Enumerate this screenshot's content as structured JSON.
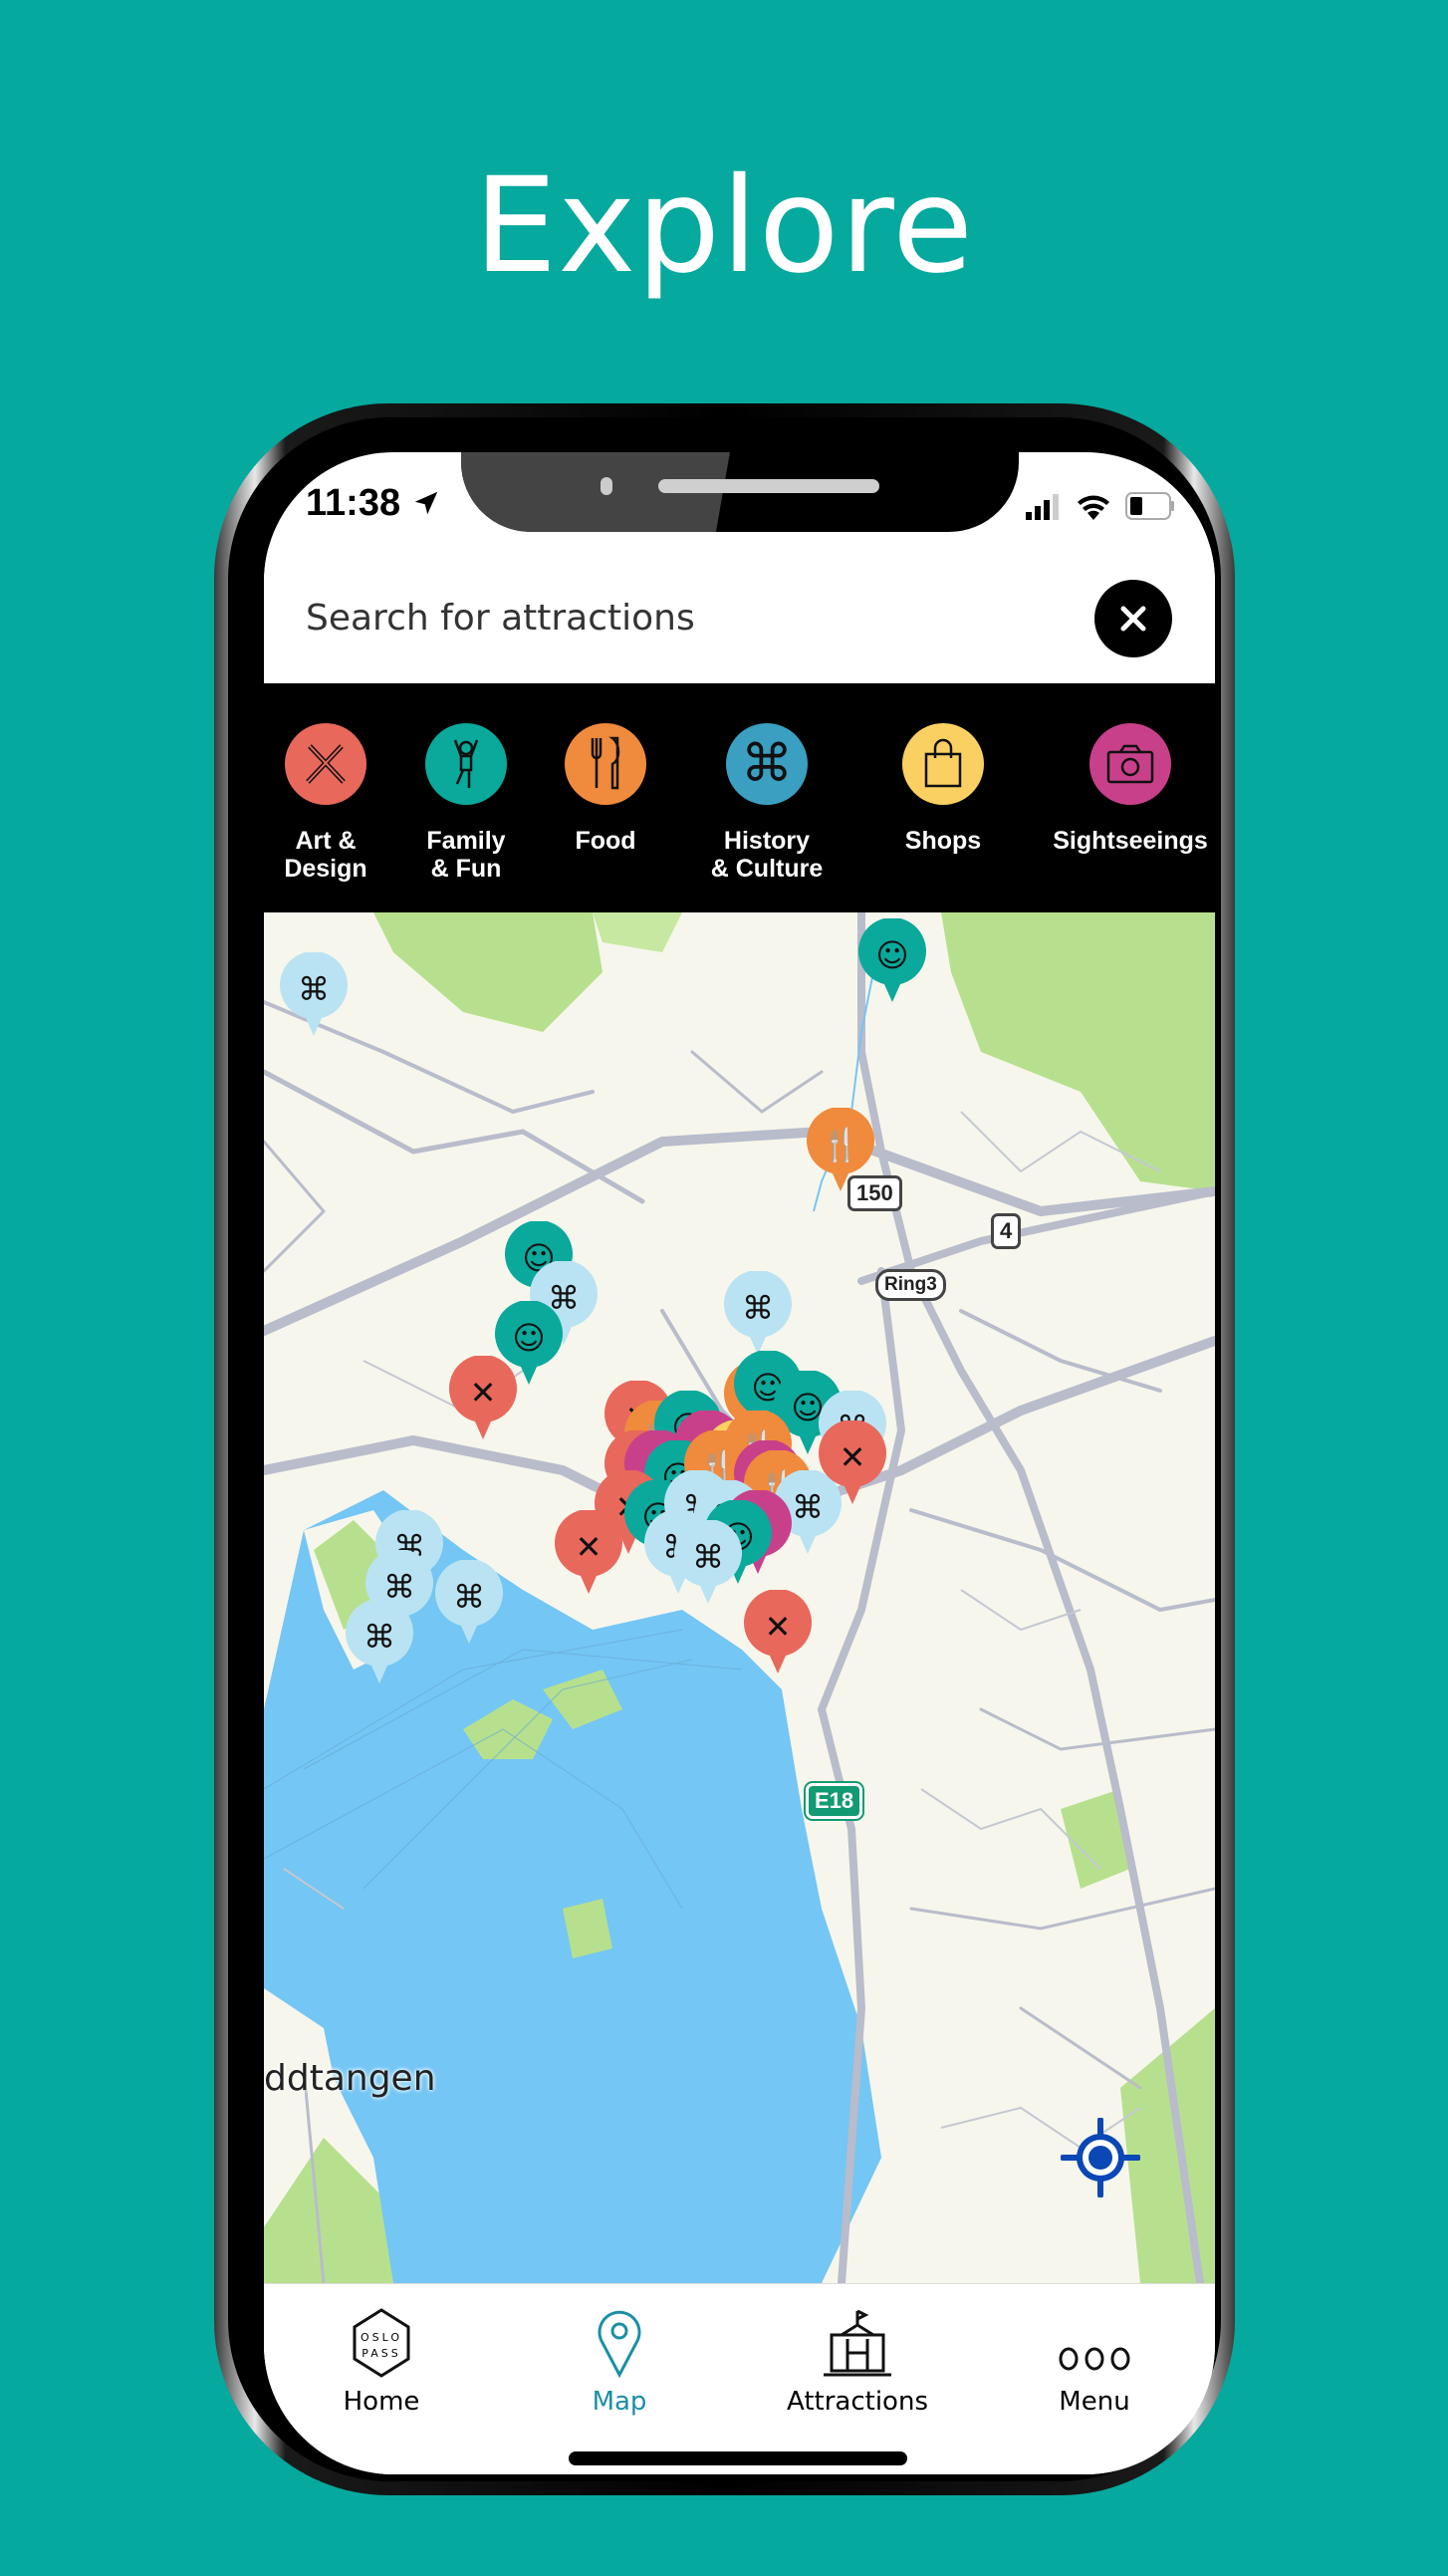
{
  "headline": "Explore",
  "status_bar": {
    "time": "11:38",
    "icons": [
      "location-arrow-icon",
      "signal-icon",
      "wifi-icon",
      "battery-icon"
    ]
  },
  "search": {
    "placeholder": "Search for attractions",
    "value": "",
    "close_icon": "close-icon"
  },
  "categories": [
    {
      "label": "Art &\nDesign",
      "icon": "pencil-brush-icon",
      "color": "#e8685c"
    },
    {
      "label": "Family\n& Fun",
      "icon": "child-jumping-icon",
      "color": "#0aa99b"
    },
    {
      "label": "Food",
      "icon": "fork-knife-icon",
      "color": "#f08a3c"
    },
    {
      "label": "History\n& Culture",
      "icon": "command-knot-icon",
      "color": "#3a9fc0"
    },
    {
      "label": "Shops",
      "icon": "shopping-bag-icon",
      "color": "#fbd062"
    },
    {
      "label": "Sightseeings",
      "icon": "camera-icon",
      "color": "#c9408a"
    }
  ],
  "map": {
    "road_shields": [
      "150",
      "4",
      "Ring3",
      "E18"
    ],
    "place_labels": [
      "ddtangen"
    ],
    "locate_icon": "locate-me-icon",
    "colors": {
      "land": "#f7f6ec",
      "water": "#74c6f4",
      "park": "#b7e08e",
      "road": "#b8bccb"
    }
  },
  "bottom_nav": {
    "items": [
      {
        "label": "Home",
        "icon": "oslo-pass-icon",
        "active": false
      },
      {
        "label": "Map",
        "icon": "map-pin-icon",
        "active": true
      },
      {
        "label": "Attractions",
        "icon": "building-icon",
        "active": false
      },
      {
        "label": "Menu",
        "icon": "more-dots-icon",
        "active": false
      }
    ],
    "logo_text": [
      "OSLO",
      "PASS"
    ],
    "active_color": "#1b8fa5"
  },
  "brand_background": "#05a99d"
}
